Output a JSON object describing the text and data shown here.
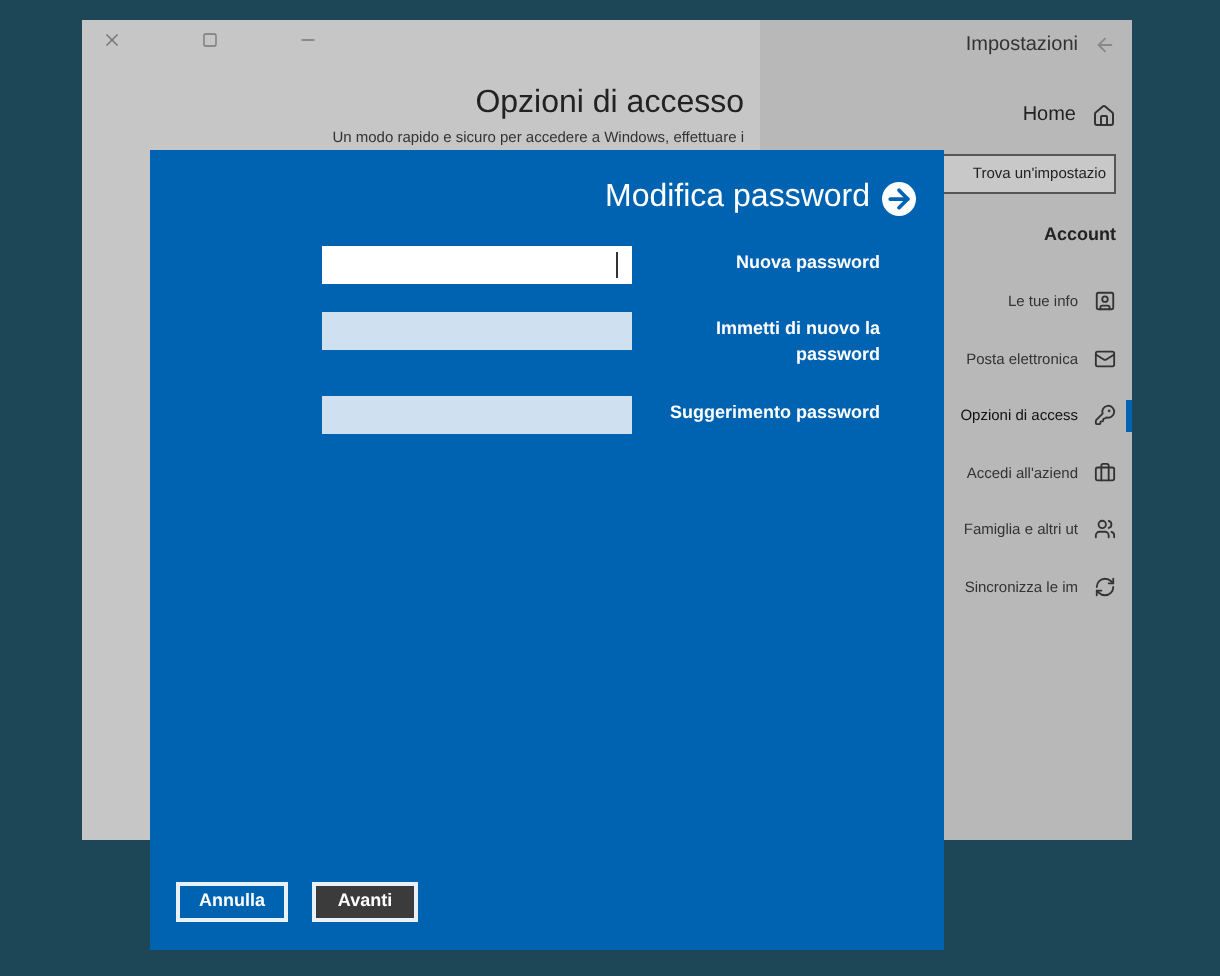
{
  "window": {
    "title": "Impostazioni"
  },
  "sidebar": {
    "home": "Home",
    "search": {
      "placeholder": "Trova un'impostazio"
    },
    "section": "Account",
    "items": [
      {
        "label": "Le tue info",
        "selected": false
      },
      {
        "label": "Posta elettronica",
        "selected": false
      },
      {
        "label": "Opzioni di access",
        "selected": true
      },
      {
        "label": "Accedi all'aziend",
        "selected": false
      },
      {
        "label": "Famiglia e altri ut",
        "selected": false
      },
      {
        "label": "Sincronizza le im",
        "selected": false
      }
    ]
  },
  "main": {
    "title": "Opzioni di accesso",
    "subtitle": "Un modo rapido e sicuro per accedere a Windows, effettuare i"
  },
  "dialog": {
    "title": "Modifica password",
    "fields": [
      {
        "label": "Nuova password",
        "focused": true
      },
      {
        "label": "Immetti di nuovo la password",
        "focused": false
      },
      {
        "label": "Suggerimento password",
        "focused": false
      }
    ],
    "buttons": [
      {
        "label": "Annulla",
        "kind": "secondary"
      },
      {
        "label": "Avanti",
        "kind": "primary"
      }
    ]
  }
}
